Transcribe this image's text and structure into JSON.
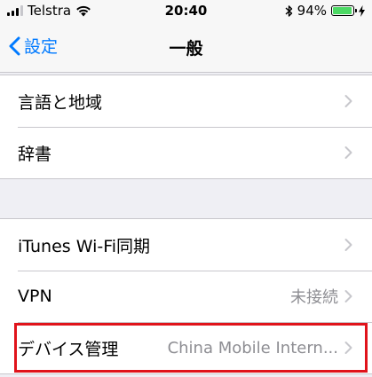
{
  "status_bar": {
    "carrier": "Telstra",
    "time": "20:40",
    "battery_percent": "94%",
    "battery_level": 0.94,
    "battery_color": "#4cd964"
  },
  "nav": {
    "back_label": "設定",
    "title": "一般"
  },
  "groups": [
    {
      "rows": [
        {
          "label": "言語と地域",
          "value": ""
        },
        {
          "label": "辞書",
          "value": ""
        }
      ]
    },
    {
      "rows": [
        {
          "label": "iTunes Wi-Fi同期",
          "value": ""
        },
        {
          "label": "VPN",
          "value": "未接続"
        },
        {
          "label": "デバイス管理",
          "value": "China Mobile Intern..."
        }
      ]
    }
  ],
  "colors": {
    "accent": "#007aff",
    "highlight": "#e0131b",
    "secondary_text": "#8e8e93"
  },
  "icons": [
    "signal-icon",
    "wifi-icon",
    "chevron-left-icon",
    "bluetooth-icon",
    "battery-icon",
    "charging-bolt-icon",
    "chevron-right-icon"
  ]
}
